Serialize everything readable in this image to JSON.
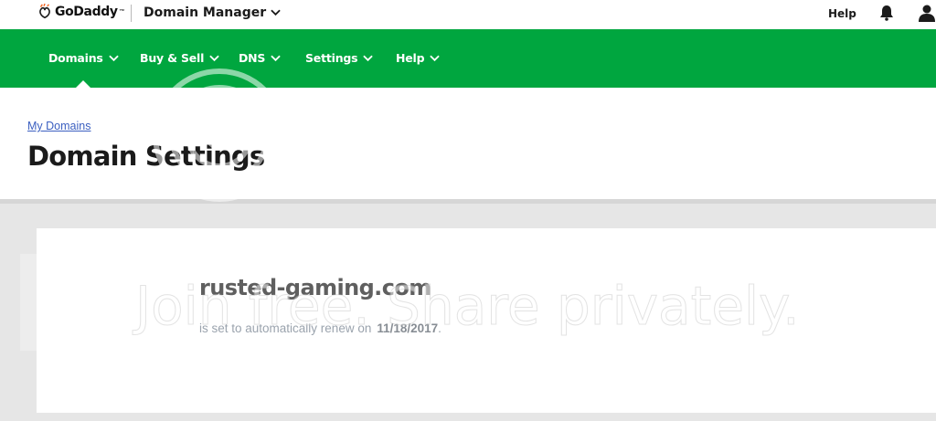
{
  "topbar": {
    "brand": "GoDaddy",
    "brand_tm": "™",
    "app_name": "Domain Manager",
    "help_label": "Help",
    "icons": {
      "logo": "godaddy-logo-icon",
      "app_menu": "chevron-down-icon",
      "notifications": "bell-icon",
      "account": "user-icon"
    }
  },
  "nav": {
    "items": [
      {
        "label": "Domains",
        "active": true
      },
      {
        "label": "Buy & Sell",
        "active": false
      },
      {
        "label": "DNS",
        "active": false
      },
      {
        "label": "Settings",
        "active": false
      },
      {
        "label": "Help",
        "active": false
      }
    ]
  },
  "header": {
    "breadcrumb": "My Domains",
    "title": "Domain Settings"
  },
  "domain_card": {
    "domain": "rusted-gaming.com",
    "renew_text": "is set to automatically renew on",
    "renew_date": "11/18/2017",
    "renew_suffix": "."
  },
  "watermark": {
    "logo_text": "photobucket",
    "tagline": "Join free. Share privately."
  },
  "colors": {
    "brand_green": "#00a63f",
    "link_blue": "#3b5fc0",
    "page_gray": "#e6e6e6"
  }
}
